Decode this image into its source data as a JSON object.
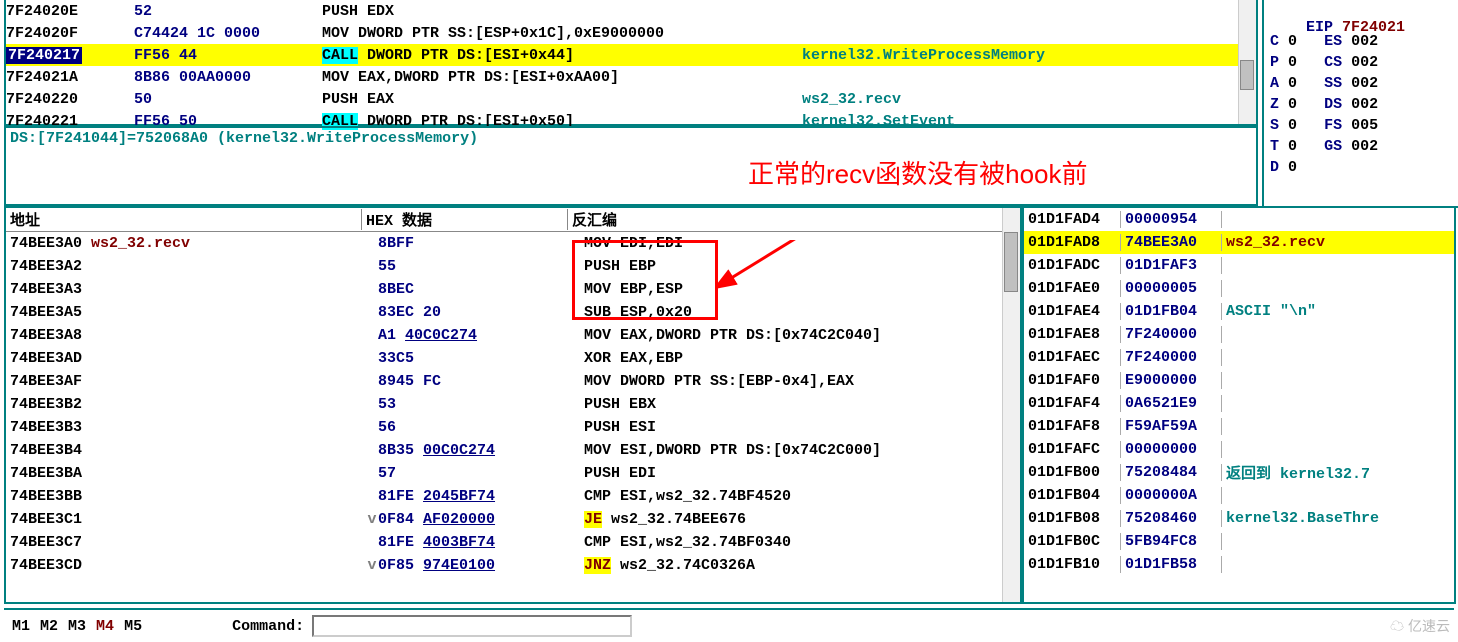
{
  "disasm_top": [
    {
      "addr": "7F24020E",
      "hex": "52",
      "asm": "PUSH EDX",
      "cmt": "",
      "hl": false
    },
    {
      "addr": "7F24020F",
      "hex": "C74424 1C 0000",
      "asm": "MOV DWORD PTR SS:[ESP+0x1C],0xE9000000",
      "cmt": "",
      "hl": false
    },
    {
      "addr": "7F240217",
      "hex": "FF56 44",
      "asm_call": "CALL",
      "asm_rest": " DWORD PTR DS:[ESI+0x44]",
      "cmt": "kernel32.WriteProcessMemory",
      "hl": true
    },
    {
      "addr": "7F24021A",
      "hex": "8B86 00AA0000",
      "asm": "MOV EAX,DWORD PTR DS:[ESI+0xAA00]",
      "cmt": "",
      "hl": false
    },
    {
      "addr": "7F240220",
      "hex": "50",
      "asm": "PUSH EAX",
      "cmt": "ws2_32.recv",
      "hl": false
    },
    {
      "addr": "7F240221",
      "hex": "FF56 50",
      "asm_call": "CALL",
      "asm_rest": " DWORD PTR DS:[ESI+0x50]",
      "cmt": "kernel32.SetEvent",
      "hl": false
    }
  ],
  "info_line": "DS:[7F241044]=752068A0 (kernel32.WriteProcessMemory)",
  "registers": {
    "eip_label": "EIP",
    "eip_val": "7F24021",
    "flags": [
      {
        "n": "C",
        "v": "0",
        "s": "ES",
        "sv": "002"
      },
      {
        "n": "P",
        "v": "0",
        "s": "CS",
        "sv": "002"
      },
      {
        "n": "A",
        "v": "0",
        "s": "SS",
        "sv": "002"
      },
      {
        "n": "Z",
        "v": "0",
        "s": "DS",
        "sv": "002"
      },
      {
        "n": "S",
        "v": "0",
        "s": "FS",
        "sv": "005"
      },
      {
        "n": "T",
        "v": "0",
        "s": "GS",
        "sv": "002"
      },
      {
        "n": "D",
        "v": "0",
        "s": "",
        "sv": ""
      }
    ]
  },
  "hex_header": {
    "addr": "地址",
    "hex": "HEX 数据",
    "dis": "反汇编"
  },
  "hex_rows": [
    {
      "a": "74BEE3A0",
      "lbl": "ws2_32.recv",
      "h": "8BFF",
      "d": "MOV EDI,EDI"
    },
    {
      "a": "74BEE3A2",
      "h": "55",
      "d": "PUSH EBP"
    },
    {
      "a": "74BEE3A3",
      "h": "8BEC",
      "d": "MOV EBP,ESP"
    },
    {
      "a": "74BEE3A5",
      "h": "83EC 20",
      "d": "SUB ESP,0x20"
    },
    {
      "a": "74BEE3A8",
      "h": "A1 ",
      "hl": "40C0C274",
      "d": "MOV EAX,DWORD PTR DS:[0x74C2C040]"
    },
    {
      "a": "74BEE3AD",
      "h": "33C5",
      "d": "XOR EAX,EBP"
    },
    {
      "a": "74BEE3AF",
      "h": "8945 FC",
      "d": "MOV DWORD PTR SS:[EBP-0x4],EAX"
    },
    {
      "a": "74BEE3B2",
      "h": "53",
      "d": "PUSH EBX"
    },
    {
      "a": "74BEE3B3",
      "h": "56",
      "d": "PUSH ESI"
    },
    {
      "a": "74BEE3B4",
      "h": "8B35 ",
      "hl": "00C0C274",
      "d": "MOV ESI,DWORD PTR DS:[0x74C2C000]"
    },
    {
      "a": "74BEE3BA",
      "h": "57",
      "d": "PUSH EDI"
    },
    {
      "a": "74BEE3BB",
      "h": "81FE ",
      "hl": "2045BF74",
      "d": "CMP ESI,ws2_32.74BF4520"
    },
    {
      "a": "74BEE3C1",
      "h": "0F84 ",
      "hl": "AF020000",
      "jmp": "JE",
      "d": " ws2_32.74BEE676",
      "exp": "v"
    },
    {
      "a": "74BEE3C7",
      "h": "81FE ",
      "hl": "4003BF74",
      "d": "CMP ESI,ws2_32.74BF0340"
    },
    {
      "a": "74BEE3CD",
      "h": "0F85 ",
      "hl": "974E0100",
      "jmp": "JNZ",
      "d": " ws2_32.74C0326A",
      "exp": "v"
    }
  ],
  "stack": [
    {
      "a": "01D1FAD4",
      "v": "00000954",
      "c": ""
    },
    {
      "a": "01D1FAD8",
      "v": "74BEE3A0",
      "c": "ws2_32.recv",
      "hl": true
    },
    {
      "a": "01D1FADC",
      "v": "01D1FAF3",
      "c": ""
    },
    {
      "a": "01D1FAE0",
      "v": "00000005",
      "c": ""
    },
    {
      "a": "01D1FAE4",
      "v": "01D1FB04",
      "c": "ASCII \"\\n\""
    },
    {
      "a": "01D1FAE8",
      "v": "7F240000",
      "c": ""
    },
    {
      "a": "01D1FAEC",
      "v": "7F240000",
      "c": ""
    },
    {
      "a": "01D1FAF0",
      "v": "E9000000",
      "c": ""
    },
    {
      "a": "01D1FAF4",
      "v": "0A6521E9",
      "c": ""
    },
    {
      "a": "01D1FAF8",
      "v": "F59AF59A",
      "c": ""
    },
    {
      "a": "01D1FAFC",
      "v": "00000000",
      "c": ""
    },
    {
      "a": "01D1FB00",
      "v": "75208484",
      "c": "返回到 kernel32.7"
    },
    {
      "a": "01D1FB04",
      "v": "0000000A",
      "c": ""
    },
    {
      "a": "01D1FB08",
      "v": "75208460",
      "c": "kernel32.BaseThre"
    },
    {
      "a": "01D1FB0C",
      "v": "5FB94FC8",
      "c": ""
    },
    {
      "a": "01D1FB10",
      "v": "01D1FB58",
      "c": ""
    }
  ],
  "annotation": "正常的recv函数没有被hook前",
  "cmd": {
    "m1": "M1",
    "m2": "M2",
    "m3": "M3",
    "m4": "M4",
    "m5": "M5",
    "label": "Command:",
    "value": ""
  },
  "watermark": "☁ 亿速云"
}
